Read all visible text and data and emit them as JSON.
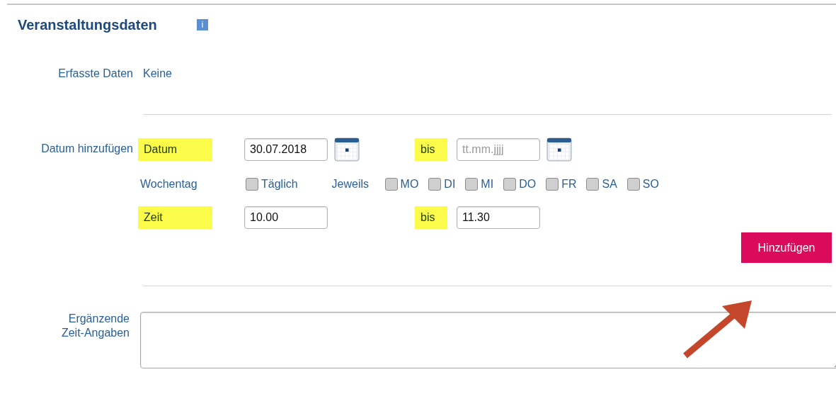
{
  "section": {
    "title": "Veranstaltungsdaten",
    "info_icon": "i"
  },
  "recorded": {
    "label": "Erfasste Daten",
    "value": "Keine"
  },
  "add_date": {
    "label": "Datum hinzufügen",
    "date": {
      "label": "Datum",
      "highlighted": true,
      "value": "30.07.2018",
      "to_label": "bis",
      "to_highlighted": true,
      "to_placeholder": "tt.mm.jjjj"
    },
    "weekday": {
      "label": "Wochentag",
      "daily": {
        "label": "Täglich",
        "checked": false
      },
      "each_label": "Jeweils",
      "days": [
        {
          "label": "MO",
          "checked": false
        },
        {
          "label": "DI",
          "checked": false
        },
        {
          "label": "MI",
          "checked": false
        },
        {
          "label": "DO",
          "checked": false
        },
        {
          "label": "FR",
          "checked": false
        },
        {
          "label": "SA",
          "checked": false
        },
        {
          "label": "SO",
          "checked": false
        }
      ]
    },
    "time": {
      "label": "Zeit",
      "highlighted": true,
      "from": "10.00",
      "to_label": "bis",
      "to_highlighted": true,
      "to": "11.30"
    },
    "button": "Hinzufügen"
  },
  "notes": {
    "label": "Ergänzende Zeit-Angaben"
  }
}
